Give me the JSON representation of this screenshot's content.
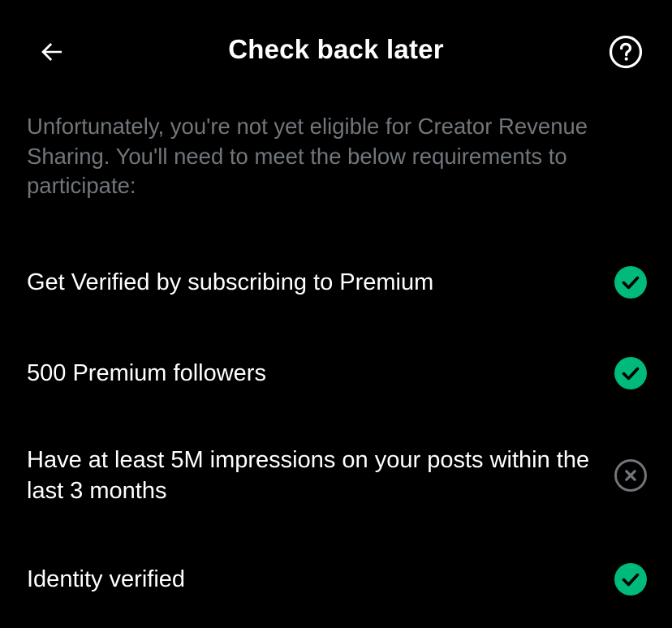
{
  "header": {
    "title": "Check back later",
    "back_icon": "arrow-left-icon",
    "help_icon": "question-circle-icon"
  },
  "intro_text": "Unfortunately, you're not yet eligible for Creator Revenue Sharing. You'll need to meet the below requirements to participate:",
  "requirements": [
    {
      "label": "Get Verified by subscribing to Premium",
      "status": "met",
      "icon": "check-circle-icon"
    },
    {
      "label": "500 Premium followers",
      "status": "met",
      "icon": "check-circle-icon"
    },
    {
      "label": "Have at least 5M impressions on your posts within the last 3 months",
      "status": "not-met",
      "icon": "x-circle-icon"
    },
    {
      "label": "Identity verified",
      "status": "met",
      "icon": "check-circle-icon"
    }
  ],
  "colors": {
    "background": "#000000",
    "text_primary": "#ffffff",
    "text_secondary": "#71767b",
    "success": "#00ba7c",
    "muted_icon": "#71767b"
  }
}
